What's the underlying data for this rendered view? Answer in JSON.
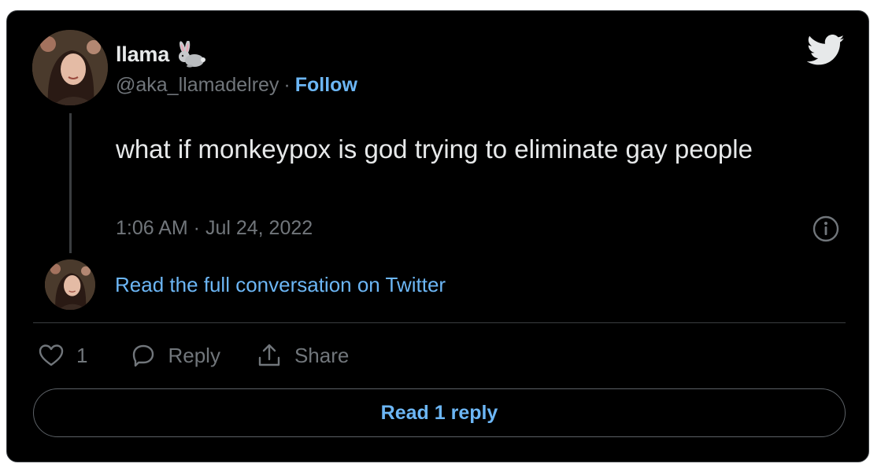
{
  "tweet": {
    "author_name": "llama",
    "author_emoji": "rabbit-icon",
    "handle": "@aka_llamadelrey",
    "separator": "·",
    "follow_label": "Follow",
    "text": "what if monkeypox is god trying to eliminate gay people",
    "timestamp": "1:06 AM · Jul 24, 2022"
  },
  "conversation": {
    "link_label": "Read the full conversation on Twitter"
  },
  "actions": {
    "like_count": "1",
    "reply_label": "Reply",
    "share_label": "Share"
  },
  "read_replies_label": "Read 1 reply",
  "colors": {
    "background": "#000000",
    "text": "#e7e9ea",
    "muted": "#71767b",
    "link": "#6cb6f5",
    "border": "#3a3d40"
  },
  "icons": {
    "brand": "twitter-bird-icon",
    "info": "info-icon",
    "like": "heart-icon",
    "reply": "speech-bubble-icon",
    "share": "share-upload-icon"
  }
}
